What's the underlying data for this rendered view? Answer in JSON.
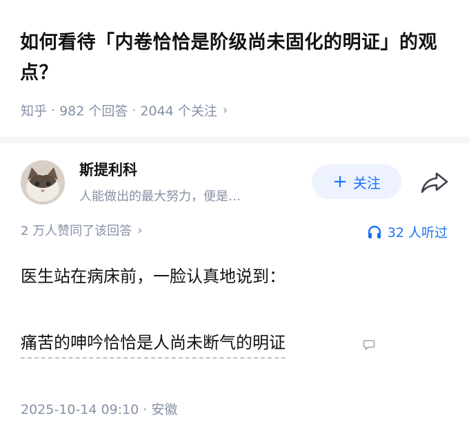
{
  "question": {
    "title": "如何看待「内卷恰恰是阶级尚未固化的明证」的观点？",
    "source": "知乎",
    "answers": "982 个回答",
    "followers": "2044 个关注"
  },
  "answer": {
    "author_name": "斯提利科",
    "author_bio": "人能做出的最大努力，便是…",
    "follow_label": "关注",
    "votes_text": "2 万人赞同了该回答",
    "listen_text": "32 人听过",
    "content_line1": "医生站在病床前，一脸认真地说到：",
    "content_line2": "痛苦的呻吟恰恰是人尚未断气的明证",
    "footer": "2025-10-14 09:10 · 安徽"
  },
  "colors": {
    "accent": "#1772f6",
    "meta": "#8590a6",
    "follow_bg": "#eef2ff"
  }
}
